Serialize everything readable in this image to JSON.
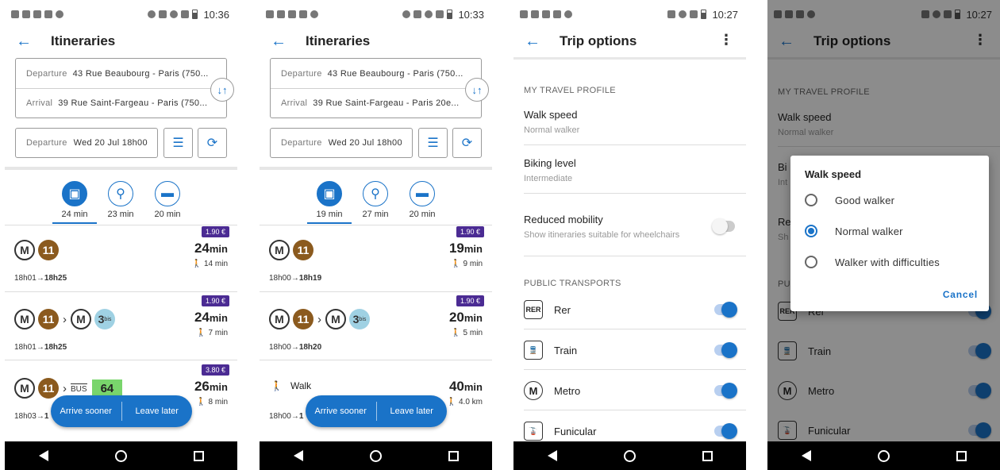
{
  "status": {
    "p1": {
      "time": "10:36"
    },
    "p2": {
      "time": "10:33"
    },
    "p3": {
      "time": "10:27"
    },
    "p4": {
      "time": "10:27"
    }
  },
  "itin1": {
    "title": "Itineraries",
    "departure_label": "Departure",
    "departure_value": "43 Rue Beaubourg - Paris (750...",
    "arrival_label": "Arrival",
    "arrival_value": "39 Rue Saint-Fargeau - Paris (750...",
    "date_label": "Departure",
    "date_value": "Wed 20 Jul 18h00",
    "modes": [
      "24 min",
      "23 min",
      "20 min"
    ],
    "results": [
      {
        "price": "1.90 €",
        "duration": "24",
        "unit": "min",
        "walk": "14 min",
        "start": "18h01",
        "end": "18h25",
        "line": "11"
      },
      {
        "price": "1.90 €",
        "duration": "24",
        "unit": "min",
        "walk": "7 min",
        "start": "18h01",
        "end": "18h25",
        "line": "11",
        "line2": "3",
        "line2_sup": "bis"
      },
      {
        "price": "3.80 €",
        "duration": "26",
        "unit": "min",
        "walk": "8 min",
        "start": "18h03",
        "end": "1",
        "line": "11",
        "bus_label": "BUS",
        "bus": "64"
      }
    ],
    "fab": {
      "left": "Arrive sooner",
      "right": "Leave later"
    }
  },
  "itin2": {
    "title": "Itineraries",
    "departure_label": "Departure",
    "departure_value": "43 Rue Beaubourg - Paris (750...",
    "arrival_label": "Arrival",
    "arrival_value": "39 Rue Saint-Fargeau - Paris 20e...",
    "date_label": "Departure",
    "date_value": "Wed 20 Jul 18h00",
    "modes": [
      "19 min",
      "27 min",
      "20 min"
    ],
    "results": [
      {
        "price": "1.90 €",
        "duration": "19",
        "unit": "min",
        "walk": "9 min",
        "start": "18h00",
        "end": "18h19",
        "line": "11"
      },
      {
        "price": "1.90 €",
        "duration": "20",
        "unit": "min",
        "walk": "5 min",
        "start": "18h00",
        "end": "18h20",
        "line": "11",
        "line2": "3",
        "line2_sup": "bis"
      },
      {
        "walk_label": "Walk",
        "duration": "40",
        "unit": "min",
        "walk": "4.0 km",
        "start": "18h00",
        "end": "1"
      }
    ],
    "fab": {
      "left": "Arrive sooner",
      "right": "Leave later"
    }
  },
  "trip": {
    "title": "Trip options",
    "section1": "MY TRAVEL PROFILE",
    "walk_title": "Walk speed",
    "walk_value": "Normal walker",
    "bike_title": "Biking level",
    "bike_value": "Intermediate",
    "rm_title": "Reduced mobility",
    "rm_sub": "Show itineraries suitable for wheelchairs",
    "section2": "PUBLIC TRANSPORTS",
    "transports": [
      {
        "icon": "RER",
        "label": "Rer"
      },
      {
        "icon": "🚆",
        "label": "Train"
      },
      {
        "icon": "M",
        "label": "Metro"
      },
      {
        "icon": "🚡",
        "label": "Funicular"
      }
    ]
  },
  "dialog": {
    "title": "Walk speed",
    "options": [
      "Good walker",
      "Normal walker",
      "Walker with difficulties"
    ],
    "selected": 1,
    "cancel": "Cancel",
    "bg_partial_bike": "Bi",
    "bg_partial_bike_sub": "Int",
    "bg_partial_rm": "Re",
    "bg_partial_rm_sub": "Sh",
    "bg_partial_section": "PU",
    "bg_rer_partial": "Rer"
  },
  "colors": {
    "accent": "#1a73c8",
    "price": "#4b2b93",
    "line11": "#8b5a1e",
    "line3bis": "#9fd1e3",
    "bus64": "#79d56c"
  }
}
